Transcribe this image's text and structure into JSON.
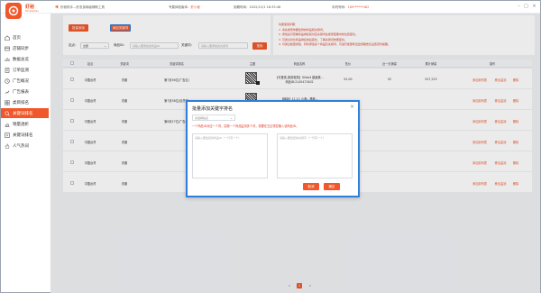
{
  "app": {
    "logo_text": "虾秘",
    "logo_sub": "Shopeemax",
    "ad_text": "虾秘助手—虾皮保姆级辅助工具",
    "version_label": "专属体验版本：",
    "version_tag": "虾小秘",
    "expire_text": "到期时间：2022/12/1 16:33:46",
    "user_label": "手机号码：",
    "user_phone": "185******482"
  },
  "sidebar": {
    "items": [
      {
        "label": "首页",
        "icon": "home-icon"
      },
      {
        "label": "店铺同步",
        "icon": "sync-icon"
      },
      {
        "label": "数据总览",
        "icon": "chart-icon"
      },
      {
        "label": "订单监测",
        "icon": "order-icon"
      },
      {
        "label": "广告概况",
        "icon": "ad-icon"
      },
      {
        "label": "广告报表",
        "icon": "report-icon"
      },
      {
        "label": "类目排名",
        "icon": "category-icon"
      },
      {
        "label": "关键词排名",
        "icon": "keyword-icon",
        "active": true
      },
      {
        "label": "销量透析",
        "icon": "sales-icon"
      },
      {
        "label": "关键词排名",
        "icon": "rank-icon"
      },
      {
        "label": "人气热词",
        "icon": "hot-icon"
      }
    ]
  },
  "toolbar": {
    "add_product_label": "批量添加",
    "add_keyword_label": "添加关键词",
    "site_label": "站点：",
    "site_value": "全部",
    "product_id_label": "商品ID：",
    "product_id_placeholder": "请输入要添加的商品ID",
    "keyword_label": "关键词：",
    "keyword_placeholder": "请输入要添加的关键词",
    "search_label": "搜索"
  },
  "tips": {
    "title": "功能使用步骤：",
    "lines": [
      "1. 请先搜索你要监测的商品和关键词。",
      "2. 添加后可查看商品排名和对应关键词在搜索结果中的位置变化。",
      "3. 可通过对比商品排名前后变化，了解关键词效果变化。",
      "4. 可通过批量添加，同时添加多个商品及关键词，可进行批量导出监测报告及设置定时提醒。"
    ]
  },
  "table": {
    "headers": [
      "站点",
      "关键词",
      "关键词排名",
      "主图",
      "商品名称",
      "售价",
      "近一天销量",
      "累计销量",
      "操作"
    ],
    "rows": [
      {
        "site": "中国台湾",
        "keyword": "衣服",
        "rank": "第7页36位(广告位)",
        "name": "【可爱風,原創韓風】Gilda4 超级美...",
        "name2": "商品ID:2145473402",
        "price": "91.00",
        "day_sales": "52",
        "total_sales": "917,213",
        "op1": "添加到列表",
        "op2": "移出监测",
        "op3": "删除"
      },
      {
        "site": "中国台湾",
        "keyword": "衣服",
        "rank": "第7页38位(自然位)",
        "name": "【韩版】11.11 小巷…等款…",
        "name2": "",
        "price": "",
        "day_sales": "",
        "total_sales": "",
        "op1": "添加到列表",
        "op2": "移出监测",
        "op3": "删除"
      },
      {
        "site": "中国台湾",
        "keyword": "衣服",
        "rank": "第8页27位(广告位)",
        "name": "",
        "name2": "",
        "price": "",
        "day_sales": "",
        "total_sales": "",
        "op1": "添加到列表",
        "op2": "移出监测",
        "op3": "删除"
      },
      {
        "site": "中国台湾",
        "keyword": "衣服",
        "rank": "",
        "name": "",
        "name2": "",
        "price": "",
        "day_sales": "",
        "total_sales": "",
        "op1": "添加到列表",
        "op2": "移出监测",
        "op3": "删除"
      },
      {
        "site": "中国台湾",
        "keyword": "衣服",
        "rank": "",
        "name": "",
        "name2": "",
        "price": "",
        "day_sales": "",
        "total_sales": "",
        "op1": "添加到列表",
        "op2": "移出监测",
        "op3": "删除"
      },
      {
        "site": "中国台湾",
        "keyword": "衣服",
        "rank": "",
        "name": "",
        "name2": "",
        "price": "",
        "day_sales": "",
        "total_sales": "",
        "op1": "添加到列表",
        "op2": "移出监测",
        "op3": "删除"
      }
    ]
  },
  "pagination": {
    "prev": "<",
    "current": "1",
    "next": ">"
  },
  "modal": {
    "title": "批量添加关键字排名",
    "close": "×",
    "select_placeholder": "请选择站点",
    "warning": "一个商品ID对应一个词，如需一个商品监测多个词，需要在左边重复输入该商品ID。",
    "ta_left_placeholder": "请输入要监控的商品ID（一行写一个）",
    "ta_right_placeholder": "请输入要监控的关键字（一行写一个）",
    "cancel_label": "取消",
    "confirm_label": "确定"
  },
  "colors": {
    "accent": "#f0582b",
    "modal_border": "#2f7fd8",
    "warning": "#e0392b"
  }
}
